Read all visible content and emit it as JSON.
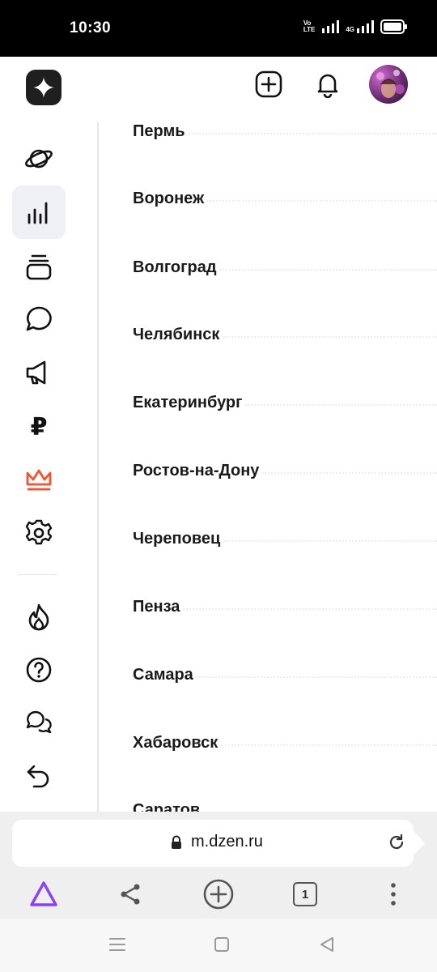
{
  "status_bar": {
    "time": "10:30",
    "volte_top": "Vo",
    "volte_bottom": "LTE",
    "network": "4G"
  },
  "header": {
    "logo_icon": "dzen-star-logo",
    "add_icon": "plus-square-icon",
    "bell_icon": "bell-icon"
  },
  "sidebar": {
    "items": [
      {
        "icon": "planet-icon"
      },
      {
        "icon": "bar-chart-icon",
        "active": true
      },
      {
        "icon": "stack-icon"
      },
      {
        "icon": "chat-bubble-icon"
      },
      {
        "icon": "megaphone-icon"
      },
      {
        "icon": "ruble-icon",
        "glyph": "₽"
      },
      {
        "icon": "crown-icon",
        "color": "#f2542d"
      },
      {
        "icon": "gear-icon"
      },
      {
        "icon": "fire-icon"
      },
      {
        "icon": "help-icon"
      },
      {
        "icon": "comments-icon"
      },
      {
        "icon": "back-arrow-icon"
      }
    ]
  },
  "cities": [
    "Пермь",
    "Воронеж",
    "Волгоград",
    "Челябинск",
    "Екатеринбург",
    "Ростов-на-Дону",
    "Череповец",
    "Пенза",
    "Самара",
    "Хабаровск",
    "Саратов"
  ],
  "browser": {
    "url": "m.dzen.ru",
    "tabs_count": "1",
    "alice_color": "#8a3ffc"
  }
}
